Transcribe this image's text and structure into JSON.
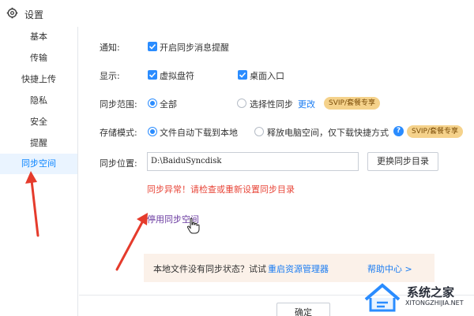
{
  "window": {
    "title": "设置",
    "settings_icon": "gear-icon"
  },
  "sidebar": {
    "items": [
      {
        "label": "基本",
        "active": false
      },
      {
        "label": "传输",
        "active": false
      },
      {
        "label": "快捷上传",
        "active": false
      },
      {
        "label": "隐私",
        "active": false
      },
      {
        "label": "安全",
        "active": false
      },
      {
        "label": "提醒",
        "active": false
      },
      {
        "label": "同步空间",
        "active": true
      }
    ],
    "active_color": "#0a84ff"
  },
  "notify": {
    "label": "通知:",
    "option": "开启同步消息提醒",
    "checked": true
  },
  "display": {
    "label": "显示:",
    "options": [
      {
        "label": "虚拟盘符",
        "checked": true
      },
      {
        "label": "桌面入口",
        "checked": true
      }
    ]
  },
  "sync_scope": {
    "label": "同步范围:",
    "options": [
      {
        "label": "全部",
        "selected": true
      },
      {
        "label": "选择性同步",
        "selected": false
      }
    ],
    "change_link": "更改",
    "badge": "SVIP/套餐专享"
  },
  "storage_mode": {
    "label": "存储模式:",
    "options": [
      {
        "label": "文件自动下载到本地",
        "selected": true
      },
      {
        "label": "释放电脑空间，仅下载快捷方式",
        "selected": false
      }
    ],
    "help_icon": "question-icon",
    "badge": "SVIP/套餐专享"
  },
  "sync_location": {
    "label": "同步位置:",
    "path": "D:\\BaiduSyncdisk",
    "change_button": "更换同步目录"
  },
  "error_text": "同步异常！请检查或重新设置同步目录",
  "disable_link": "停用同步空间",
  "infobar": {
    "question": "本地文件没有同步状态？试试",
    "restart_link": "重启资源管理器",
    "help_link": "帮助中心 >"
  },
  "footer": {
    "confirm_label": "确定"
  },
  "watermark": {
    "name": "系统之家",
    "domain": "XITONGZHIJIA.NET"
  },
  "colors": {
    "accent": "#2a8cff",
    "error": "#e8473a",
    "badge_bg": "#f5d28b",
    "arrow": "#e53b2c"
  }
}
